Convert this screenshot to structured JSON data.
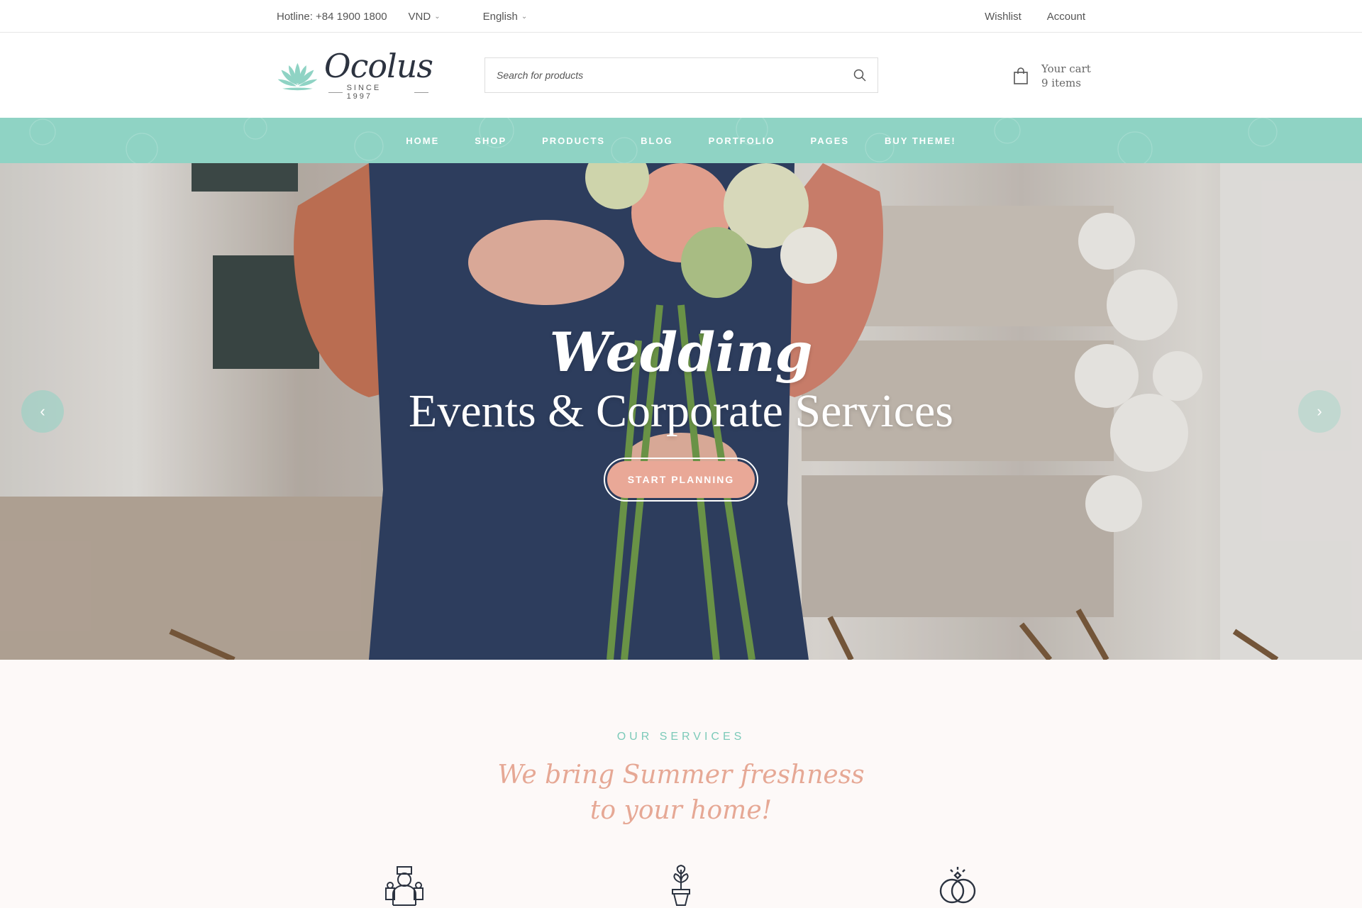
{
  "topbar": {
    "hotline": "Hotline: +84 1900 1800",
    "currency": "VND",
    "language": "English",
    "wishlist": "Wishlist",
    "account": "Account"
  },
  "header": {
    "logo_name": "Ocolus",
    "logo_since": "SINCE 1997",
    "search_placeholder": "Search for products",
    "cart_label": "Your cart",
    "cart_count": "9 items"
  },
  "nav": {
    "items": [
      "HOME",
      "SHOP",
      "PRODUCTS",
      "BLOG",
      "PORTFOLIO",
      "PAGES",
      "BUY THEME!"
    ]
  },
  "hero": {
    "title_script": "Wedding",
    "title_main": "Events & Corporate Services",
    "cta": "START PLANNING"
  },
  "services": {
    "eyebrow": "OUR SERVICES",
    "title_line1": "We bring Summer freshness",
    "title_line2": "to your home!",
    "icons": [
      "florist-icon",
      "potted-plant-icon",
      "wedding-rings-icon"
    ]
  },
  "colors": {
    "accent_mint": "#8fd3c4",
    "accent_peach": "#e9a897",
    "dark_text": "#2c3340"
  }
}
